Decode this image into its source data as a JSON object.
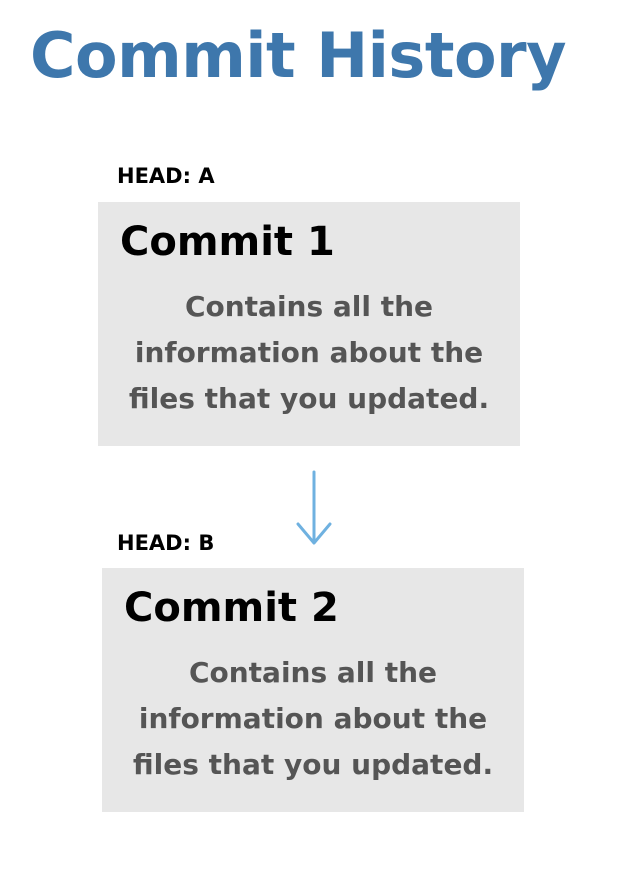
{
  "title": "Commit History",
  "colors": {
    "title": "#3e77ac",
    "arrow": "#6fb1e0",
    "box_background": "#e7e7e7",
    "description_text": "#555555"
  },
  "commits": [
    {
      "head_label": "HEAD: A",
      "title": "Commit 1",
      "description_lines": [
        "Contains all the",
        "information about the",
        "files that you updated."
      ]
    },
    {
      "head_label": "HEAD: B",
      "title": "Commit 2",
      "description_lines": [
        "Contains all the",
        "information about the",
        "files that you updated."
      ]
    }
  ],
  "connector": {
    "icon": "arrow-down-icon",
    "direction": "down"
  }
}
